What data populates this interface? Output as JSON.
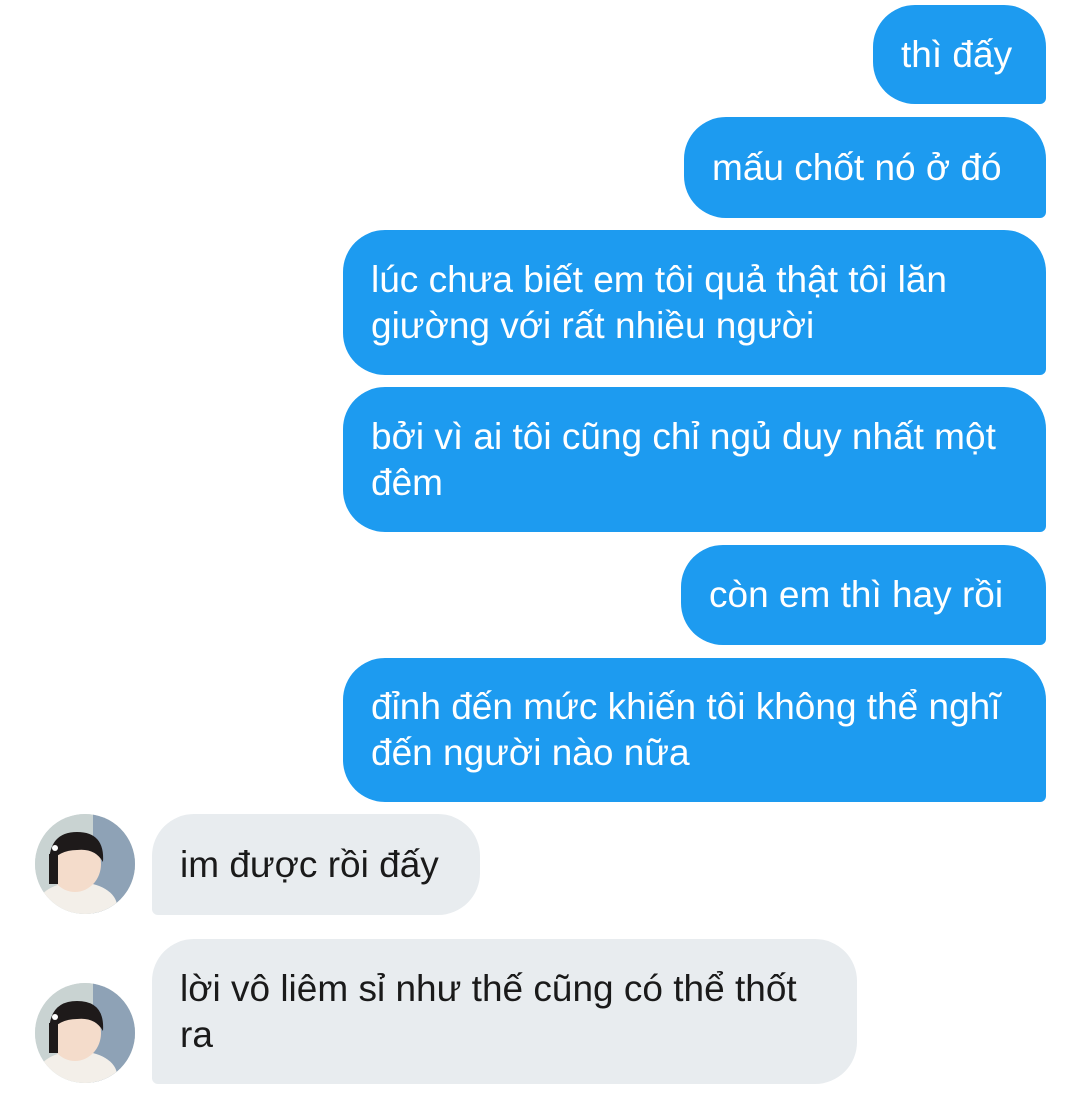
{
  "conversation": {
    "messages": [
      {
        "direction": "outgoing",
        "text": "thì đấy"
      },
      {
        "direction": "outgoing",
        "text": "mấu chốt nó ở đó"
      },
      {
        "direction": "outgoing",
        "text": "lúc chưa biết em tôi quả thật tôi lăn giường với rất nhiều người"
      },
      {
        "direction": "outgoing",
        "text": "bởi vì ai tôi cũng chỉ ngủ duy nhất một đêm"
      },
      {
        "direction": "outgoing",
        "text": "còn em thì hay rồi"
      },
      {
        "direction": "outgoing",
        "text": "đỉnh đến mức khiến tôi không thể nghĩ đến người nào nữa"
      },
      {
        "direction": "incoming",
        "text": "im được rồi đấy"
      },
      {
        "direction": "incoming",
        "text": "lời vô liêm sỉ như thế cũng có thể thốt ra"
      }
    ]
  },
  "colors": {
    "outgoing_bubble": "#1d9bf0",
    "incoming_bubble": "#e8ecef"
  }
}
